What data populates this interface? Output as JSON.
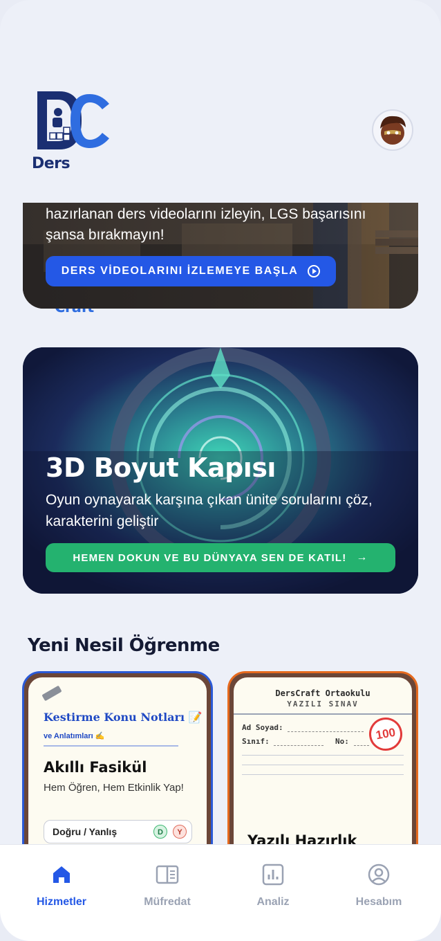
{
  "brand": {
    "logo_part1": "Ders",
    "logo_part2": "Craft"
  },
  "header": {
    "avatar_icon": "user-avatar-icon"
  },
  "banner_videos": {
    "description": "hazırlanan ders videolarını izleyin, LGS başarısını şansa bırakmayın!",
    "button_label": "DERS VİDEOLARINI İZLEMEYE BAŞLA",
    "button_icon": "play-circle-icon",
    "accent": "#2458e6"
  },
  "banner_portal": {
    "title": "3D Boyut Kapısı",
    "description": "Oyun oynayarak karşına çıkan ünite sorularını çöz, karakterini geliştir",
    "button_label": "HEMEN DOKUN VE BU DÜNYAYA SEN DE KATIL!",
    "button_icon": "arrow-right-icon",
    "accent": "#24b26f"
  },
  "section": {
    "title": "Yeni Nesil Öğrenme"
  },
  "cards": {
    "fasikul": {
      "handwriting_title": "Kestirme Konu Notları 📝",
      "handwriting_sub": "ve Anlatımları ✍️",
      "title": "Akıllı Fasikül",
      "subtitle": "Hem Öğren, Hem Etkinlik Yap!",
      "quiz_label": "Doğru / Yanlış",
      "chip_true": "D",
      "chip_false": "Y",
      "border_color": "#2a59d6"
    },
    "yazili": {
      "school": "DersCraft Ortaokulu",
      "exam": "YAZILI SINAV",
      "name_label": "Ad Soyad:",
      "class_label": "Sınıf:",
      "no_label": "No:",
      "score": "100",
      "title": "Yazılı Hazırlık",
      "border_color": "#e66a1e"
    }
  },
  "nav": {
    "items": [
      {
        "label": "Hizmetler",
        "icon": "home-icon",
        "active": true
      },
      {
        "label": "Müfredat",
        "icon": "book-open-icon",
        "active": false
      },
      {
        "label": "Analiz",
        "icon": "bar-chart-icon",
        "active": false
      },
      {
        "label": "Hesabım",
        "icon": "user-circle-icon",
        "active": false
      }
    ]
  }
}
